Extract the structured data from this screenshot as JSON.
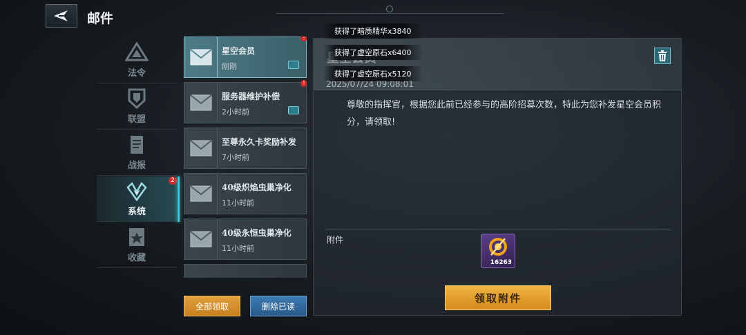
{
  "header": {
    "title": "邮件"
  },
  "categories": [
    {
      "label": "法令",
      "icon": "emblem-icon",
      "active": false,
      "badge": ""
    },
    {
      "label": "联盟",
      "icon": "shield-icon",
      "active": false,
      "badge": ""
    },
    {
      "label": "战报",
      "icon": "report-icon",
      "active": false,
      "badge": ""
    },
    {
      "label": "系统",
      "icon": "wings-icon",
      "active": true,
      "badge": "2"
    },
    {
      "label": "收藏",
      "icon": "star-icon",
      "active": false,
      "badge": ""
    }
  ],
  "mails": [
    {
      "subject": "星空会员",
      "time": "刚刚",
      "unread": true,
      "has_attachment": true,
      "active": true,
      "badge": "!"
    },
    {
      "subject": "服务器维护补偿",
      "time": "2小时前",
      "unread": true,
      "has_attachment": true,
      "active": false,
      "badge": "!"
    },
    {
      "subject": "至尊永久卡奖励补发",
      "time": "7小时前",
      "unread": false,
      "has_attachment": false,
      "active": false,
      "badge": ""
    },
    {
      "subject": "40级炽焰虫巢净化",
      "time": "11小时前",
      "unread": false,
      "has_attachment": false,
      "active": false,
      "badge": ""
    },
    {
      "subject": "40级永恒虫巢净化",
      "time": "11小时前",
      "unread": false,
      "has_attachment": false,
      "active": false,
      "badge": ""
    }
  ],
  "list_actions": {
    "claim_all": "全部领取",
    "delete_read": "删除已读"
  },
  "detail": {
    "title": "星空会员",
    "date": "2025/07/24  09:08:01",
    "body": "尊敬的指挥官，根据您此前已经参与的高阶招募次数，特此为您补发星空会员积分，请领取!",
    "attachments_label": "附件",
    "reward_count": "16263",
    "claim_button": "领取附件"
  },
  "toasts": [
    "获得了暗质精华x3840",
    "获得了虚空原石x6400",
    "获得了虚空原石x5120"
  ],
  "colors": {
    "accent": "#45c8d6",
    "gold": "#e2a13d",
    "badge_red": "#d02a2a"
  }
}
